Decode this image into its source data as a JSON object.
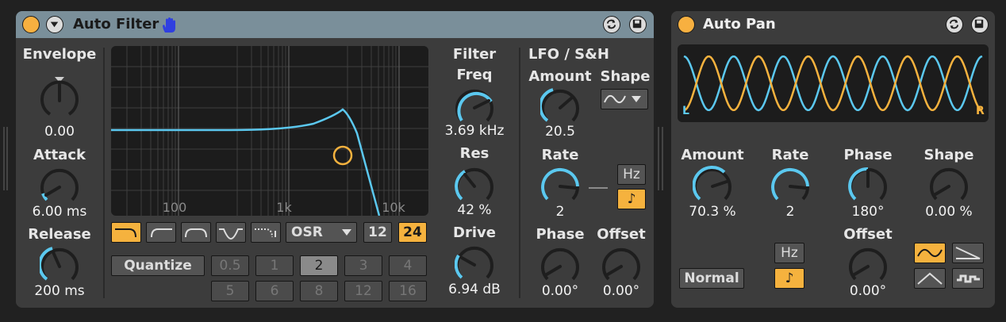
{
  "auto_filter": {
    "title": "Auto Filter",
    "envelope": {
      "section_label": "Envelope",
      "amount_value": "0.00",
      "attack_label": "Attack",
      "attack_value": "6.00 ms",
      "release_label": "Release",
      "release_value": "200 ms"
    },
    "graph": {
      "tick_labels": [
        "100",
        "1k",
        "10k"
      ]
    },
    "filter_types": [
      "lowpass",
      "highpass",
      "bandpass",
      "notch",
      "morph"
    ],
    "filter_type_selected": "lowpass",
    "circuit": "OSR",
    "slopes": [
      "12",
      "24"
    ],
    "slope_selected": "24",
    "quantize_label": "Quantize",
    "quantize_values": [
      "0.5",
      "1",
      "2",
      "3",
      "4",
      "5",
      "6",
      "8",
      "12",
      "16"
    ],
    "quantize_selected": "2",
    "filter": {
      "section_label": "Filter",
      "freq_label": "Freq",
      "freq_value": "3.69 kHz",
      "res_label": "Res",
      "res_value": "42 %",
      "drive_label": "Drive",
      "drive_value": "6.94 dB"
    },
    "lfo": {
      "section_label": "LFO / S&H",
      "amount_label": "Amount",
      "amount_value": "20.5",
      "shape_label": "Shape",
      "rate_label": "Rate",
      "rate_value": "2",
      "hz_label": "Hz",
      "phase_label": "Phase",
      "phase_value": "0.00°",
      "offset_label": "Offset",
      "offset_value": "0.00°"
    }
  },
  "auto_pan": {
    "title": "Auto Pan",
    "display": {
      "left_label": "L",
      "right_label": "R"
    },
    "amount_label": "Amount",
    "amount_value": "70.3 %",
    "rate_label": "Rate",
    "rate_value": "2",
    "phase_label": "Phase",
    "phase_value": "180°",
    "shape_label": "Shape",
    "shape_value": "0.00 %",
    "mode_label": "Normal",
    "hz_label": "Hz",
    "offset_label": "Offset",
    "offset_value": "0.00°"
  },
  "colors": {
    "accent": "#f5b23e",
    "knob_arc": "#5bc8ef",
    "title_bar_active": "#7a8f9a",
    "device_bg": "#3c3c3c"
  }
}
